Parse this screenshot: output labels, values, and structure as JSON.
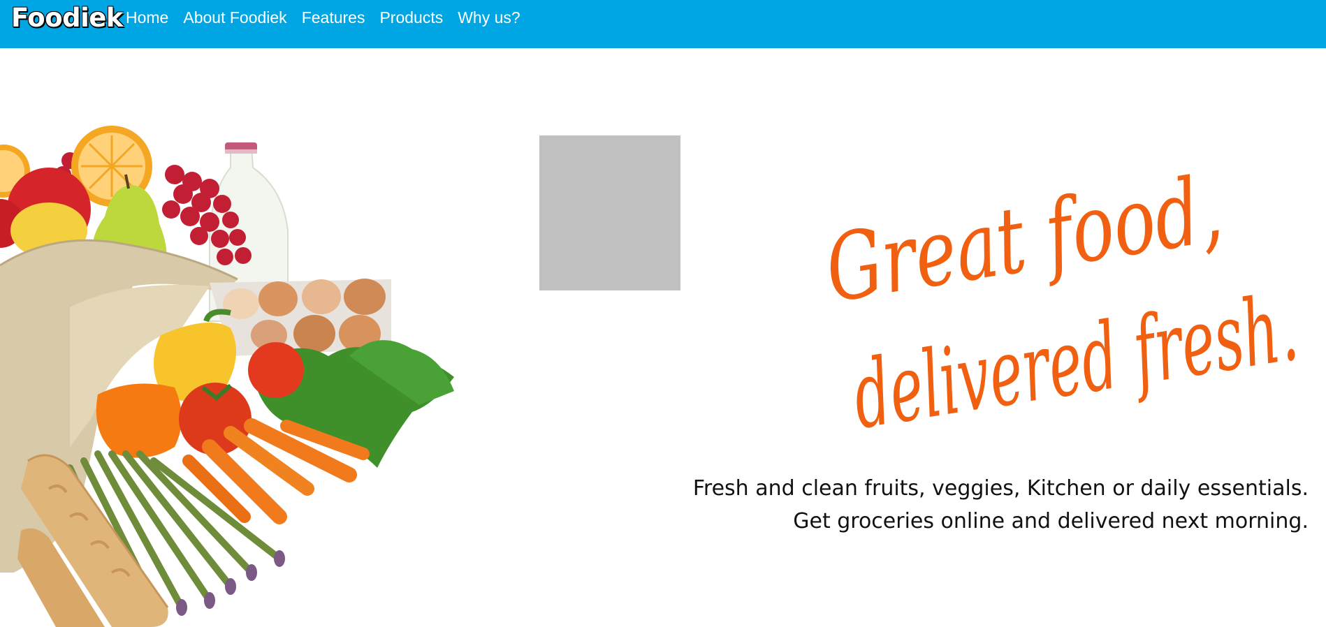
{
  "nav": {
    "brand": "Foodiek",
    "links": [
      "Home",
      "About Foodiek",
      "Features",
      "Products",
      "Why us?"
    ]
  },
  "hero": {
    "headline_line1": "Great food,",
    "headline_line2": "delivered fresh.",
    "tagline_line1": "Fresh and clean fruits, veggies, Kitchen or daily essentials.",
    "tagline_line2": "Get groceries online and delivered next morning."
  },
  "colors": {
    "navbar": "#00a5e3",
    "headline": "#f06010",
    "placeholder": "#c0c0c0"
  }
}
